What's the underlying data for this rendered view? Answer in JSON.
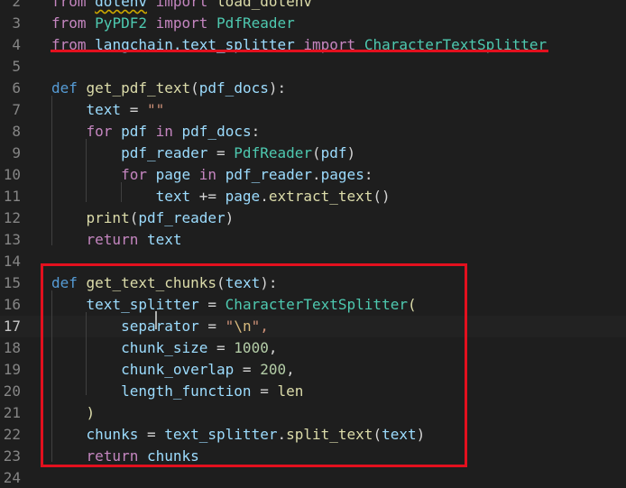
{
  "editor": {
    "colors": {
      "background": "#1e1e1e",
      "line_number": "#858585",
      "keyword_control": "#c586c0",
      "keyword_def": "#569cd6",
      "function": "#dcdcaa",
      "variable": "#9cdcfe",
      "class": "#4ec9b0",
      "string": "#ce9178",
      "escape": "#d7ba7d",
      "number": "#b5cea8",
      "plain": "#d4d4d4",
      "annotation": "#e3101e"
    },
    "active_line": "17",
    "lines": [
      {
        "num": "2",
        "tokens": [
          {
            "t": "from",
            "c": "keyword_control"
          },
          {
            "t": " ",
            "c": "plain"
          },
          {
            "t": "dotenv",
            "c": "variable",
            "squiggle": true
          },
          {
            "t": " ",
            "c": "plain"
          },
          {
            "t": "import",
            "c": "keyword_control"
          },
          {
            "t": " ",
            "c": "plain"
          },
          {
            "t": "load_dotenv",
            "c": "function"
          }
        ]
      },
      {
        "num": "3",
        "tokens": [
          {
            "t": "from",
            "c": "keyword_control"
          },
          {
            "t": " ",
            "c": "plain"
          },
          {
            "t": "PyPDF2",
            "c": "class"
          },
          {
            "t": " ",
            "c": "plain"
          },
          {
            "t": "import",
            "c": "keyword_control"
          },
          {
            "t": " ",
            "c": "plain"
          },
          {
            "t": "PdfReader",
            "c": "class"
          }
        ]
      },
      {
        "num": "4",
        "tokens": [
          {
            "t": "from",
            "c": "keyword_control"
          },
          {
            "t": " ",
            "c": "plain"
          },
          {
            "t": "langchain.text_splitter",
            "c": "variable"
          },
          {
            "t": " ",
            "c": "plain"
          },
          {
            "t": "import",
            "c": "keyword_control"
          },
          {
            "t": " ",
            "c": "plain"
          },
          {
            "t": "CharacterTextSplitter",
            "c": "class"
          }
        ]
      },
      {
        "num": "5",
        "tokens": []
      },
      {
        "num": "6",
        "tokens": [
          {
            "t": "def",
            "c": "keyword_def"
          },
          {
            "t": " ",
            "c": "plain"
          },
          {
            "t": "get_pdf_text",
            "c": "function"
          },
          {
            "t": "(",
            "c": "plain"
          },
          {
            "t": "pdf_docs",
            "c": "variable"
          },
          {
            "t": "):",
            "c": "plain"
          }
        ]
      },
      {
        "num": "7",
        "tokens": [
          {
            "t": "    ",
            "c": "plain"
          },
          {
            "t": "text",
            "c": "variable"
          },
          {
            "t": " = ",
            "c": "plain"
          },
          {
            "t": "\"\"",
            "c": "string"
          }
        ]
      },
      {
        "num": "8",
        "tokens": [
          {
            "t": "    ",
            "c": "plain"
          },
          {
            "t": "for",
            "c": "keyword_control"
          },
          {
            "t": " ",
            "c": "plain"
          },
          {
            "t": "pdf",
            "c": "variable"
          },
          {
            "t": " ",
            "c": "plain"
          },
          {
            "t": "in",
            "c": "keyword_control"
          },
          {
            "t": " ",
            "c": "plain"
          },
          {
            "t": "pdf_docs",
            "c": "variable"
          },
          {
            "t": ":",
            "c": "plain"
          }
        ]
      },
      {
        "num": "9",
        "tokens": [
          {
            "t": "        ",
            "c": "plain"
          },
          {
            "t": "pdf_reader",
            "c": "variable"
          },
          {
            "t": " = ",
            "c": "plain"
          },
          {
            "t": "PdfReader",
            "c": "class"
          },
          {
            "t": "(",
            "c": "plain"
          },
          {
            "t": "pdf",
            "c": "variable"
          },
          {
            "t": ")",
            "c": "plain"
          }
        ]
      },
      {
        "num": "10",
        "tokens": [
          {
            "t": "        ",
            "c": "plain"
          },
          {
            "t": "for",
            "c": "keyword_control"
          },
          {
            "t": " ",
            "c": "plain"
          },
          {
            "t": "page",
            "c": "variable"
          },
          {
            "t": " ",
            "c": "plain"
          },
          {
            "t": "in",
            "c": "keyword_control"
          },
          {
            "t": " ",
            "c": "plain"
          },
          {
            "t": "pdf_reader",
            "c": "variable"
          },
          {
            "t": ".",
            "c": "plain"
          },
          {
            "t": "pages",
            "c": "variable"
          },
          {
            "t": ":",
            "c": "plain"
          }
        ]
      },
      {
        "num": "11",
        "tokens": [
          {
            "t": "            ",
            "c": "plain"
          },
          {
            "t": "text",
            "c": "variable"
          },
          {
            "t": " += ",
            "c": "plain"
          },
          {
            "t": "page",
            "c": "variable"
          },
          {
            "t": ".",
            "c": "plain"
          },
          {
            "t": "extract_text",
            "c": "function"
          },
          {
            "t": "()",
            "c": "plain"
          }
        ]
      },
      {
        "num": "12",
        "tokens": [
          {
            "t": "    ",
            "c": "plain"
          },
          {
            "t": "print",
            "c": "function"
          },
          {
            "t": "(",
            "c": "plain"
          },
          {
            "t": "pdf_reader",
            "c": "variable"
          },
          {
            "t": ")",
            "c": "plain"
          }
        ]
      },
      {
        "num": "13",
        "tokens": [
          {
            "t": "    ",
            "c": "plain"
          },
          {
            "t": "return",
            "c": "keyword_control"
          },
          {
            "t": " ",
            "c": "plain"
          },
          {
            "t": "text",
            "c": "variable"
          }
        ]
      },
      {
        "num": "14",
        "tokens": []
      },
      {
        "num": "15",
        "tokens": [
          {
            "t": "def",
            "c": "keyword_def"
          },
          {
            "t": " ",
            "c": "plain"
          },
          {
            "t": "get_text_chunks",
            "c": "function"
          },
          {
            "t": "(",
            "c": "plain"
          },
          {
            "t": "text",
            "c": "variable"
          },
          {
            "t": "):",
            "c": "plain"
          }
        ]
      },
      {
        "num": "16",
        "tokens": [
          {
            "t": "    ",
            "c": "plain"
          },
          {
            "t": "text_splitter",
            "c": "variable"
          },
          {
            "t": " = ",
            "c": "plain"
          },
          {
            "t": "CharacterTextSplitter",
            "c": "class"
          },
          {
            "t": "(",
            "c": "function"
          }
        ]
      },
      {
        "num": "17",
        "tokens": [
          {
            "t": "        ",
            "c": "plain"
          },
          {
            "t": "separator",
            "c": "variable"
          },
          {
            "t": " = ",
            "c": "plain"
          },
          {
            "t": "\"",
            "c": "string"
          },
          {
            "t": "\\n",
            "c": "escape"
          },
          {
            "t": "\",",
            "c": "string"
          }
        ]
      },
      {
        "num": "18",
        "tokens": [
          {
            "t": "        ",
            "c": "plain"
          },
          {
            "t": "chunk_size",
            "c": "variable"
          },
          {
            "t": " = ",
            "c": "plain"
          },
          {
            "t": "1000",
            "c": "number"
          },
          {
            "t": ",",
            "c": "plain"
          }
        ]
      },
      {
        "num": "19",
        "tokens": [
          {
            "t": "        ",
            "c": "plain"
          },
          {
            "t": "chunk_overlap",
            "c": "variable"
          },
          {
            "t": " = ",
            "c": "plain"
          },
          {
            "t": "200",
            "c": "number"
          },
          {
            "t": ",",
            "c": "plain"
          }
        ]
      },
      {
        "num": "20",
        "tokens": [
          {
            "t": "        ",
            "c": "plain"
          },
          {
            "t": "length_function",
            "c": "variable"
          },
          {
            "t": " = ",
            "c": "plain"
          },
          {
            "t": "len",
            "c": "function"
          }
        ]
      },
      {
        "num": "21",
        "tokens": [
          {
            "t": "    ",
            "c": "plain"
          },
          {
            "t": ")",
            "c": "function"
          }
        ]
      },
      {
        "num": "22",
        "tokens": [
          {
            "t": "    ",
            "c": "plain"
          },
          {
            "t": "chunks",
            "c": "variable"
          },
          {
            "t": " = ",
            "c": "plain"
          },
          {
            "t": "text_splitter",
            "c": "variable"
          },
          {
            "t": ".",
            "c": "plain"
          },
          {
            "t": "split_text",
            "c": "function"
          },
          {
            "t": "(",
            "c": "plain"
          },
          {
            "t": "text",
            "c": "variable"
          },
          {
            "t": ")",
            "c": "plain"
          }
        ]
      },
      {
        "num": "23",
        "tokens": [
          {
            "t": "    ",
            "c": "plain"
          },
          {
            "t": "return",
            "c": "keyword_control"
          },
          {
            "t": " ",
            "c": "plain"
          },
          {
            "t": "chunks",
            "c": "variable"
          }
        ]
      },
      {
        "num": "24",
        "tokens": []
      }
    ]
  }
}
